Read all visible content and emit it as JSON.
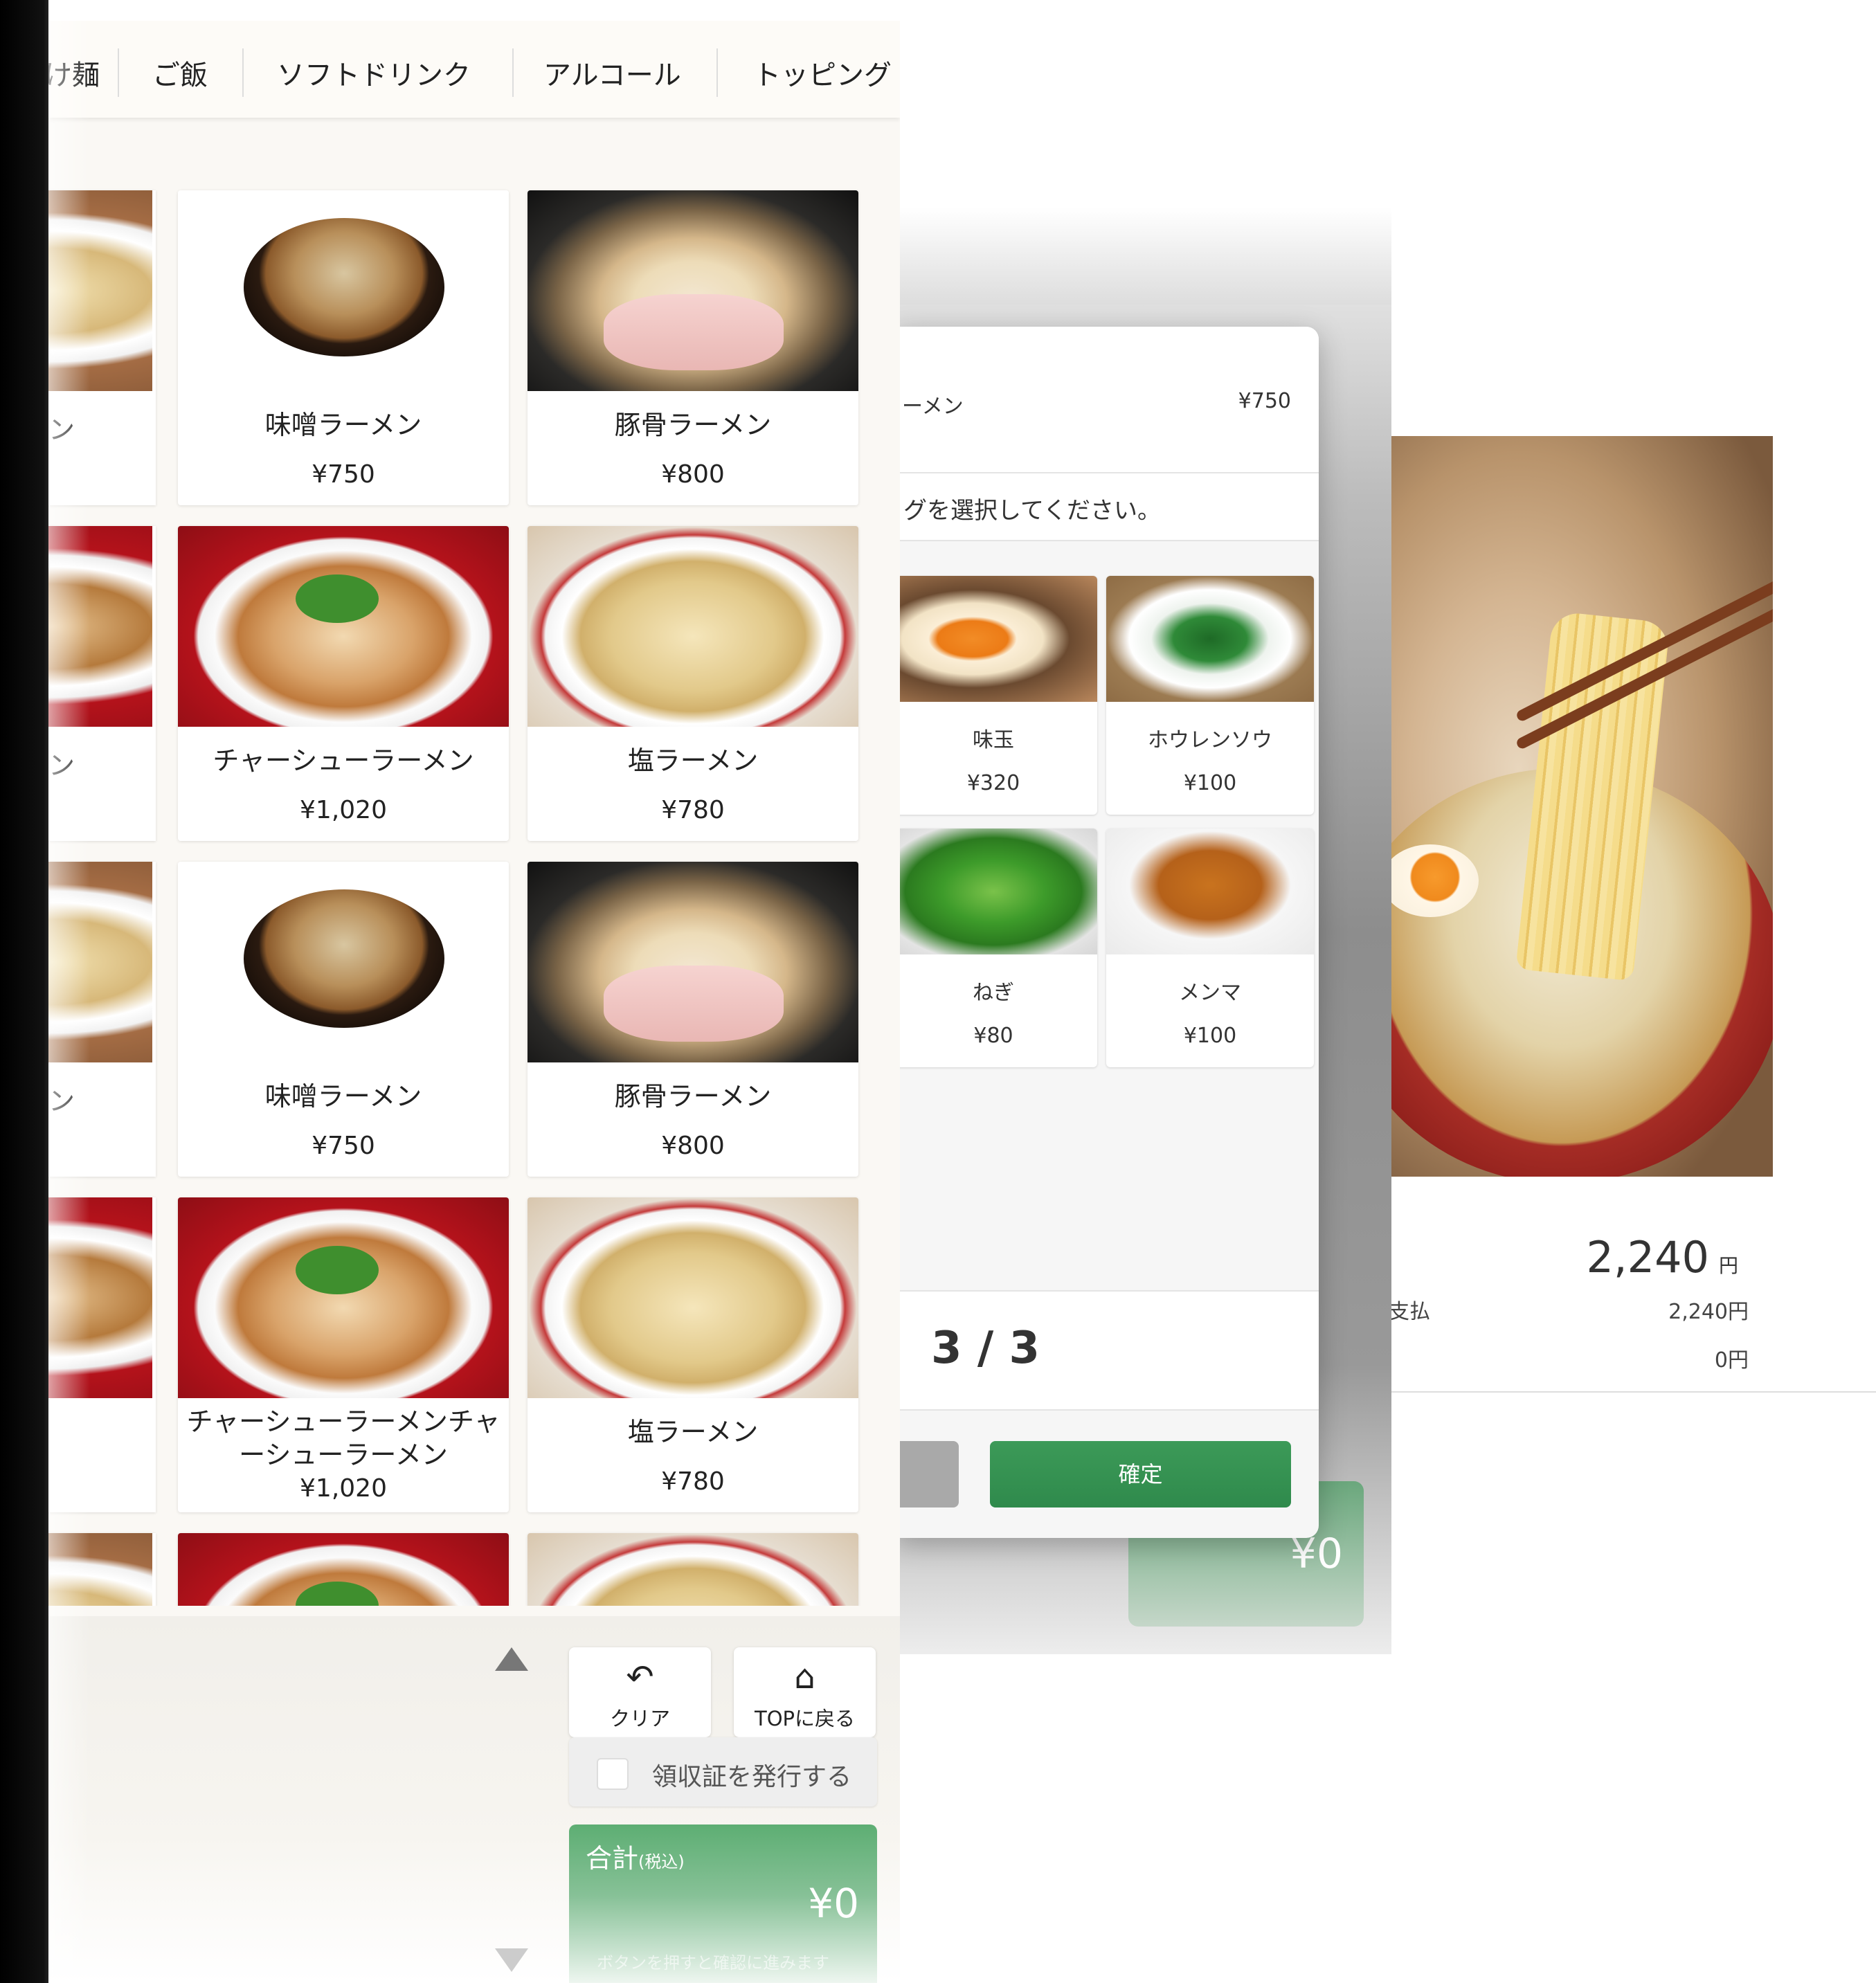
{
  "menu_screen": {
    "tabs": [
      "け麺",
      "ご飯",
      "ソフトドリンク",
      "アルコール",
      "トッピング"
    ],
    "partial_labels": [
      "ン",
      "ン",
      "ン"
    ],
    "items": [
      {
        "name": "味噌ラーメン",
        "price": "¥750",
        "photo": "miso-ramen-photo"
      },
      {
        "name": "豚骨ラーメン",
        "price": "¥800",
        "photo": "tonkotsu-ramen-photo"
      },
      {
        "name": "チャーシューラーメン",
        "price": "¥1,020",
        "photo": "chashu-ramen-photo"
      },
      {
        "name": "塩ラーメン",
        "price": "¥780",
        "photo": "shio-ramen-photo"
      },
      {
        "name": "味噌ラーメン",
        "price": "¥750",
        "photo": "miso-ramen-photo"
      },
      {
        "name": "豚骨ラーメン",
        "price": "¥800",
        "photo": "tonkotsu-ramen-photo"
      },
      {
        "name": "チャーシューラーメンチャーシューラーメン",
        "price": "¥1,020",
        "photo": "chashu-ramen-photo"
      },
      {
        "name": "塩ラーメン",
        "price": "¥780",
        "photo": "shio-ramen-photo"
      }
    ],
    "controls": {
      "clear_label": "クリア",
      "top_label": "TOPに戻る",
      "receipt_label": "領収証を発行する",
      "total_label": "合計",
      "total_tax_note": "(税込)",
      "total_value": "¥0",
      "total_hint": "ボタンを押すと確認に進みます"
    }
  },
  "topping_modal": {
    "item_name": "ーメン",
    "item_price": "¥750",
    "prompt": "グを選択してください。",
    "toppings": [
      {
        "name": "味玉",
        "price": "¥320",
        "photo": "ajitama-photo"
      },
      {
        "name": "ホウレンソウ",
        "price": "¥100",
        "photo": "spinach-photo"
      },
      {
        "name": "ねぎ",
        "price": "¥80",
        "photo": "negi-photo"
      },
      {
        "name": "メンマ",
        "price": "¥100",
        "photo": "menma-photo"
      }
    ],
    "pager": "3 / 3",
    "confirm_label": "確定",
    "bg_total_value": "¥0"
  },
  "payment_screen": {
    "total_amount": "2,240",
    "total_unit": "円",
    "rows": [
      {
        "label": "支払",
        "value": "2,240円"
      },
      {
        "label": "",
        "value": "0円"
      }
    ]
  },
  "colors": {
    "accent_green": "#3c9a58",
    "bezel": "#000000",
    "background": "#faf8f4"
  }
}
